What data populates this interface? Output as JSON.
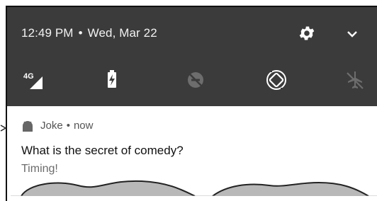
{
  "status_bar": {
    "time": "12:49 PM",
    "separator": "•",
    "date": "Wed, Mar 22",
    "network_label": "4G"
  },
  "quick_settings": [
    {
      "icon": "cellular-4g-icon"
    },
    {
      "icon": "battery-charging-icon"
    },
    {
      "icon": "do-not-disturb-off-icon"
    },
    {
      "icon": "auto-rotate-icon"
    },
    {
      "icon": "airplane-mode-icon"
    }
  ],
  "notification": {
    "app_name": "Joke",
    "separator": "•",
    "time": "now",
    "title": "What is the secret of comedy?",
    "text": "Timing!"
  },
  "colors": {
    "shade": "#3b3b3b",
    "icon_active": "#ffffff",
    "icon_inactive": "#6d6d6d"
  }
}
